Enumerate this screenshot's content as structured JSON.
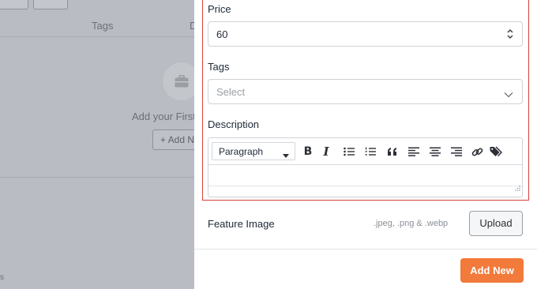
{
  "background": {
    "column_tags": "Tags",
    "column_d": "D",
    "empty_text": "Add your First",
    "add_button": "+ Add N",
    "corner_text": "s"
  },
  "drawer": {
    "price": {
      "label": "Price",
      "value": "60"
    },
    "tags": {
      "label": "Tags",
      "placeholder": "Select"
    },
    "description": {
      "label": "Description",
      "format_select": "Paragraph",
      "toolbar": [
        "bold-icon",
        "italic-icon",
        "bullet-list-icon",
        "numbered-list-icon",
        "blockquote-icon",
        "align-left-icon",
        "align-center-icon",
        "align-right-icon",
        "link-icon",
        "tag-icon"
      ]
    },
    "feature_image": {
      "label": "Feature Image",
      "hint": ".jpeg, .png & .webp",
      "upload_label": "Upload"
    },
    "submit_label": "Add New"
  },
  "colors": {
    "accent": "#f27a3a",
    "highlight": "#d9413b",
    "overlay": "#b9bcc2"
  }
}
